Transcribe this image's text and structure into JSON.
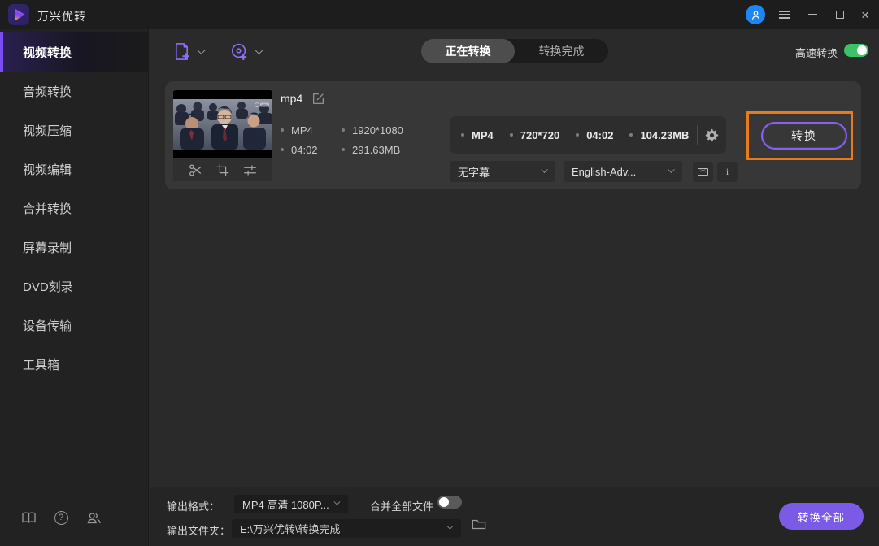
{
  "titlebar": {
    "title": "万兴优转"
  },
  "sidebar": {
    "items": [
      {
        "label": "视频转换",
        "active": true
      },
      {
        "label": "音频转换",
        "active": false
      },
      {
        "label": "视频压缩",
        "active": false
      },
      {
        "label": "视频编辑",
        "active": false
      },
      {
        "label": "合并转换",
        "active": false
      },
      {
        "label": "屏幕录制",
        "active": false
      },
      {
        "label": "DVD刻录",
        "active": false
      },
      {
        "label": "设备传输",
        "active": false
      },
      {
        "label": "工具箱",
        "active": false
      }
    ]
  },
  "toolbar": {
    "tabs": [
      {
        "label": "正在转换",
        "active": true
      },
      {
        "label": "转换完成",
        "active": false
      }
    ],
    "fast_convert_label": "高速转换",
    "fast_convert_enabled": true
  },
  "task": {
    "filename": "mp4",
    "source": {
      "format": "MP4",
      "resolution": "1920*1080",
      "duration": "04:02",
      "size": "291.63MB"
    },
    "output": {
      "format": "MP4",
      "resolution": "720*720",
      "duration": "04:02",
      "size": "104.23MB"
    },
    "subtitle_selected": "无字幕",
    "audio_track_selected": "English-Adv...",
    "subtitle_edit_glyph": "><",
    "info_glyph": "i",
    "convert_label": "转换"
  },
  "footer": {
    "output_format_label": "输出格式：",
    "output_format_value": "MP4 高清 1080P...",
    "merge_all_label": "合并全部文件",
    "merge_all_enabled": false,
    "output_folder_label": "输出文件夹：",
    "output_folder_value": "E:\\万兴优转\\转换完成",
    "convert_all_label": "转换全部"
  },
  "colors": {
    "accent_purple": "#7b5be6",
    "toggle_green": "#3cc368",
    "highlight_orange": "#e87b1b",
    "avatar_blue": "#1d86f0",
    "convert_border_purple": "#8a5ff2"
  }
}
